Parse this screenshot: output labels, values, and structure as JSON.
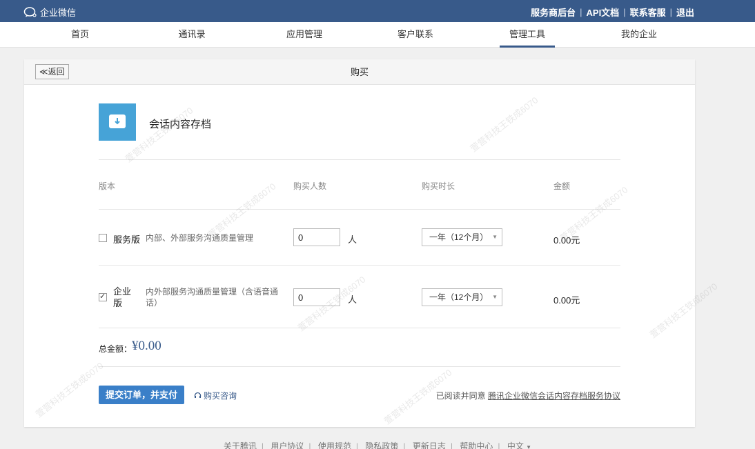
{
  "app": {
    "brand": "企业微信"
  },
  "top_links": [
    "服务商后台",
    "API文档",
    "联系客服",
    "退出"
  ],
  "nav": [
    "首页",
    "通讯录",
    "应用管理",
    "客户联系",
    "管理工具",
    "我的企业"
  ],
  "nav_active": "管理工具",
  "page": {
    "back_label": "≪返回",
    "title": "购买",
    "app_name": "会话内容存档",
    "headers": {
      "edition": "版本",
      "count": "购买人数",
      "duration": "购买时长",
      "amount": "金额"
    },
    "rows": [
      {
        "name": "服务版",
        "desc": "内部、外部服务沟通质量管理",
        "count": "0",
        "unit": "人",
        "duration": "一年（12个月）",
        "amount": "0.00元",
        "checked": false
      },
      {
        "name": "企业版",
        "desc": "内外部服务沟通质量管理（含语音通话）",
        "count": "0",
        "unit": "人",
        "duration": "一年（12个月）",
        "amount": "0.00元",
        "checked": true
      }
    ],
    "total_label": "总金额：",
    "total_value": "¥0.00",
    "pay_button": "提交订单，并支付",
    "consult_link": "购买咨询",
    "agree_prefix": "已阅读并同意",
    "agree_link": "腾讯企业微信会话内容存档服务协议"
  },
  "footer": [
    "关于腾讯",
    "用户协议",
    "使用规范",
    "隐私政策",
    "更新日志",
    "帮助中心",
    "中文"
  ],
  "watermark": "萱营科技王铁成6070",
  "colors": {
    "topbar": "#385a8a",
    "pay_button": "#3a7fc8",
    "app_icon": "#46a3d7"
  }
}
